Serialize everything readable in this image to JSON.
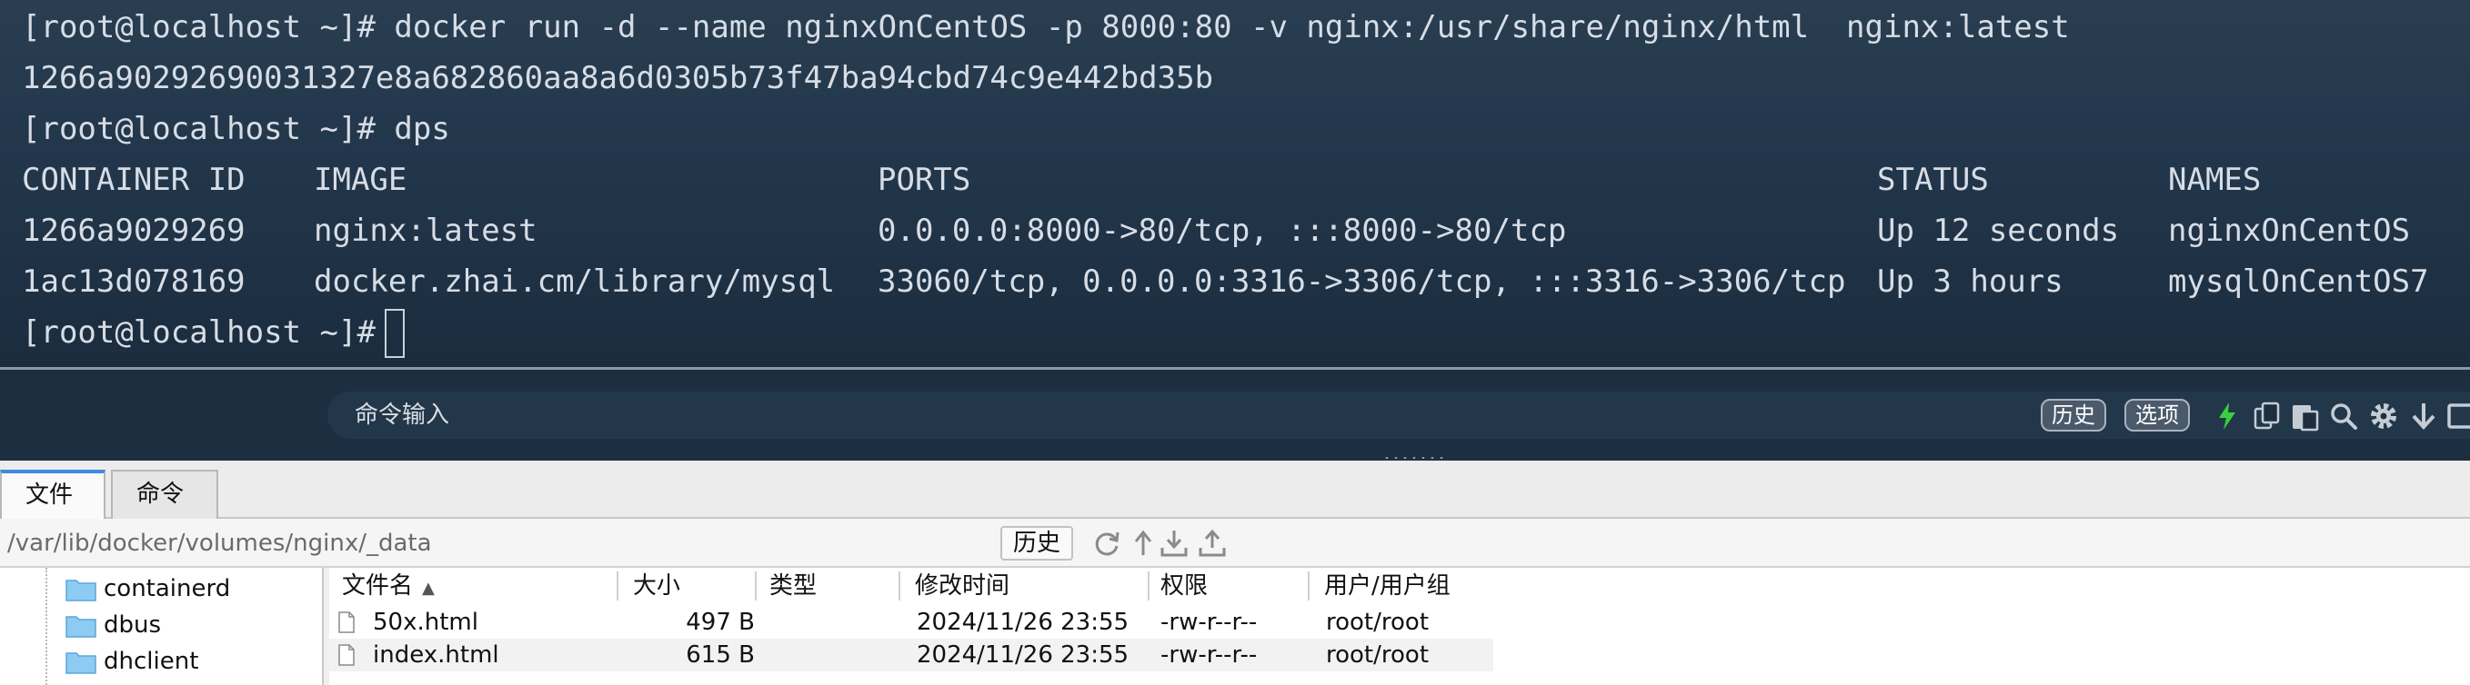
{
  "terminal": {
    "lines": [
      {
        "prompt": "[root@localhost ~]#",
        "command": " docker run -d --name nginxOnCentOS -p 8000:80 -v nginx:/usr/share/nginx/html  nginx:latest"
      },
      {
        "output": "1266a90292690031327e8a682860aa8a6d0305b73f47ba94cbd74c9e442bd35b"
      },
      {
        "prompt": "[root@localhost ~]#",
        "command": " dps"
      }
    ],
    "table": {
      "headers": [
        "CONTAINER ID",
        "IMAGE",
        "PORTS",
        "STATUS",
        "NAMES"
      ],
      "rows": [
        [
          "1266a9029269",
          "nginx:latest",
          "0.0.0.0:8000->80/tcp, :::8000->80/tcp",
          "Up 12 seconds",
          "nginxOnCentOS"
        ],
        [
          "1ac13d078169",
          "docker.zhai.cm/library/mysql",
          "33060/tcp, 0.0.0.0:3316->3306/tcp, :::3316->3306/tcp",
          "Up 3 hours",
          "mysqlOnCentOS7"
        ]
      ]
    },
    "final_prompt": "[root@localhost ~]#"
  },
  "command_bar": {
    "placeholder": "命令输入",
    "history_label": "历史",
    "options_label": "选项",
    "icons": [
      "lightning-icon",
      "copy-icon",
      "paste-icon",
      "search-icon",
      "gear-icon",
      "download-icon",
      "window-icon"
    ]
  },
  "tabs": [
    {
      "label": "文件",
      "active": true
    },
    {
      "label": "命令",
      "active": false
    }
  ],
  "path_bar": {
    "path": "/var/lib/docker/volumes/nginx/_data",
    "history_label": "历史",
    "icons": [
      "refresh-icon",
      "up-icon",
      "download-icon",
      "upload-icon"
    ]
  },
  "tree": {
    "items": [
      {
        "label": "containerd"
      },
      {
        "label": "dbus"
      },
      {
        "label": "dhclient"
      }
    ]
  },
  "files": {
    "columns": [
      "文件名",
      "大小",
      "类型",
      "修改时间",
      "权限",
      "用户/用户组"
    ],
    "rows": [
      {
        "name": "50x.html",
        "size": "497 B",
        "type": "",
        "modified": "2024/11/26 23:55",
        "perms": "-rw-r--r--",
        "owner": "root/root"
      },
      {
        "name": "index.html",
        "size": "615 B",
        "type": "",
        "modified": "2024/11/26 23:55",
        "perms": "-rw-r--r--",
        "owner": "root/root"
      }
    ]
  },
  "colors": {
    "terminal_bg": "#22364b",
    "terminal_text": "#d7dde5",
    "accent_tab": "#3d8be0",
    "lightning": "#38d13c",
    "folder": "#7ec0ee"
  }
}
